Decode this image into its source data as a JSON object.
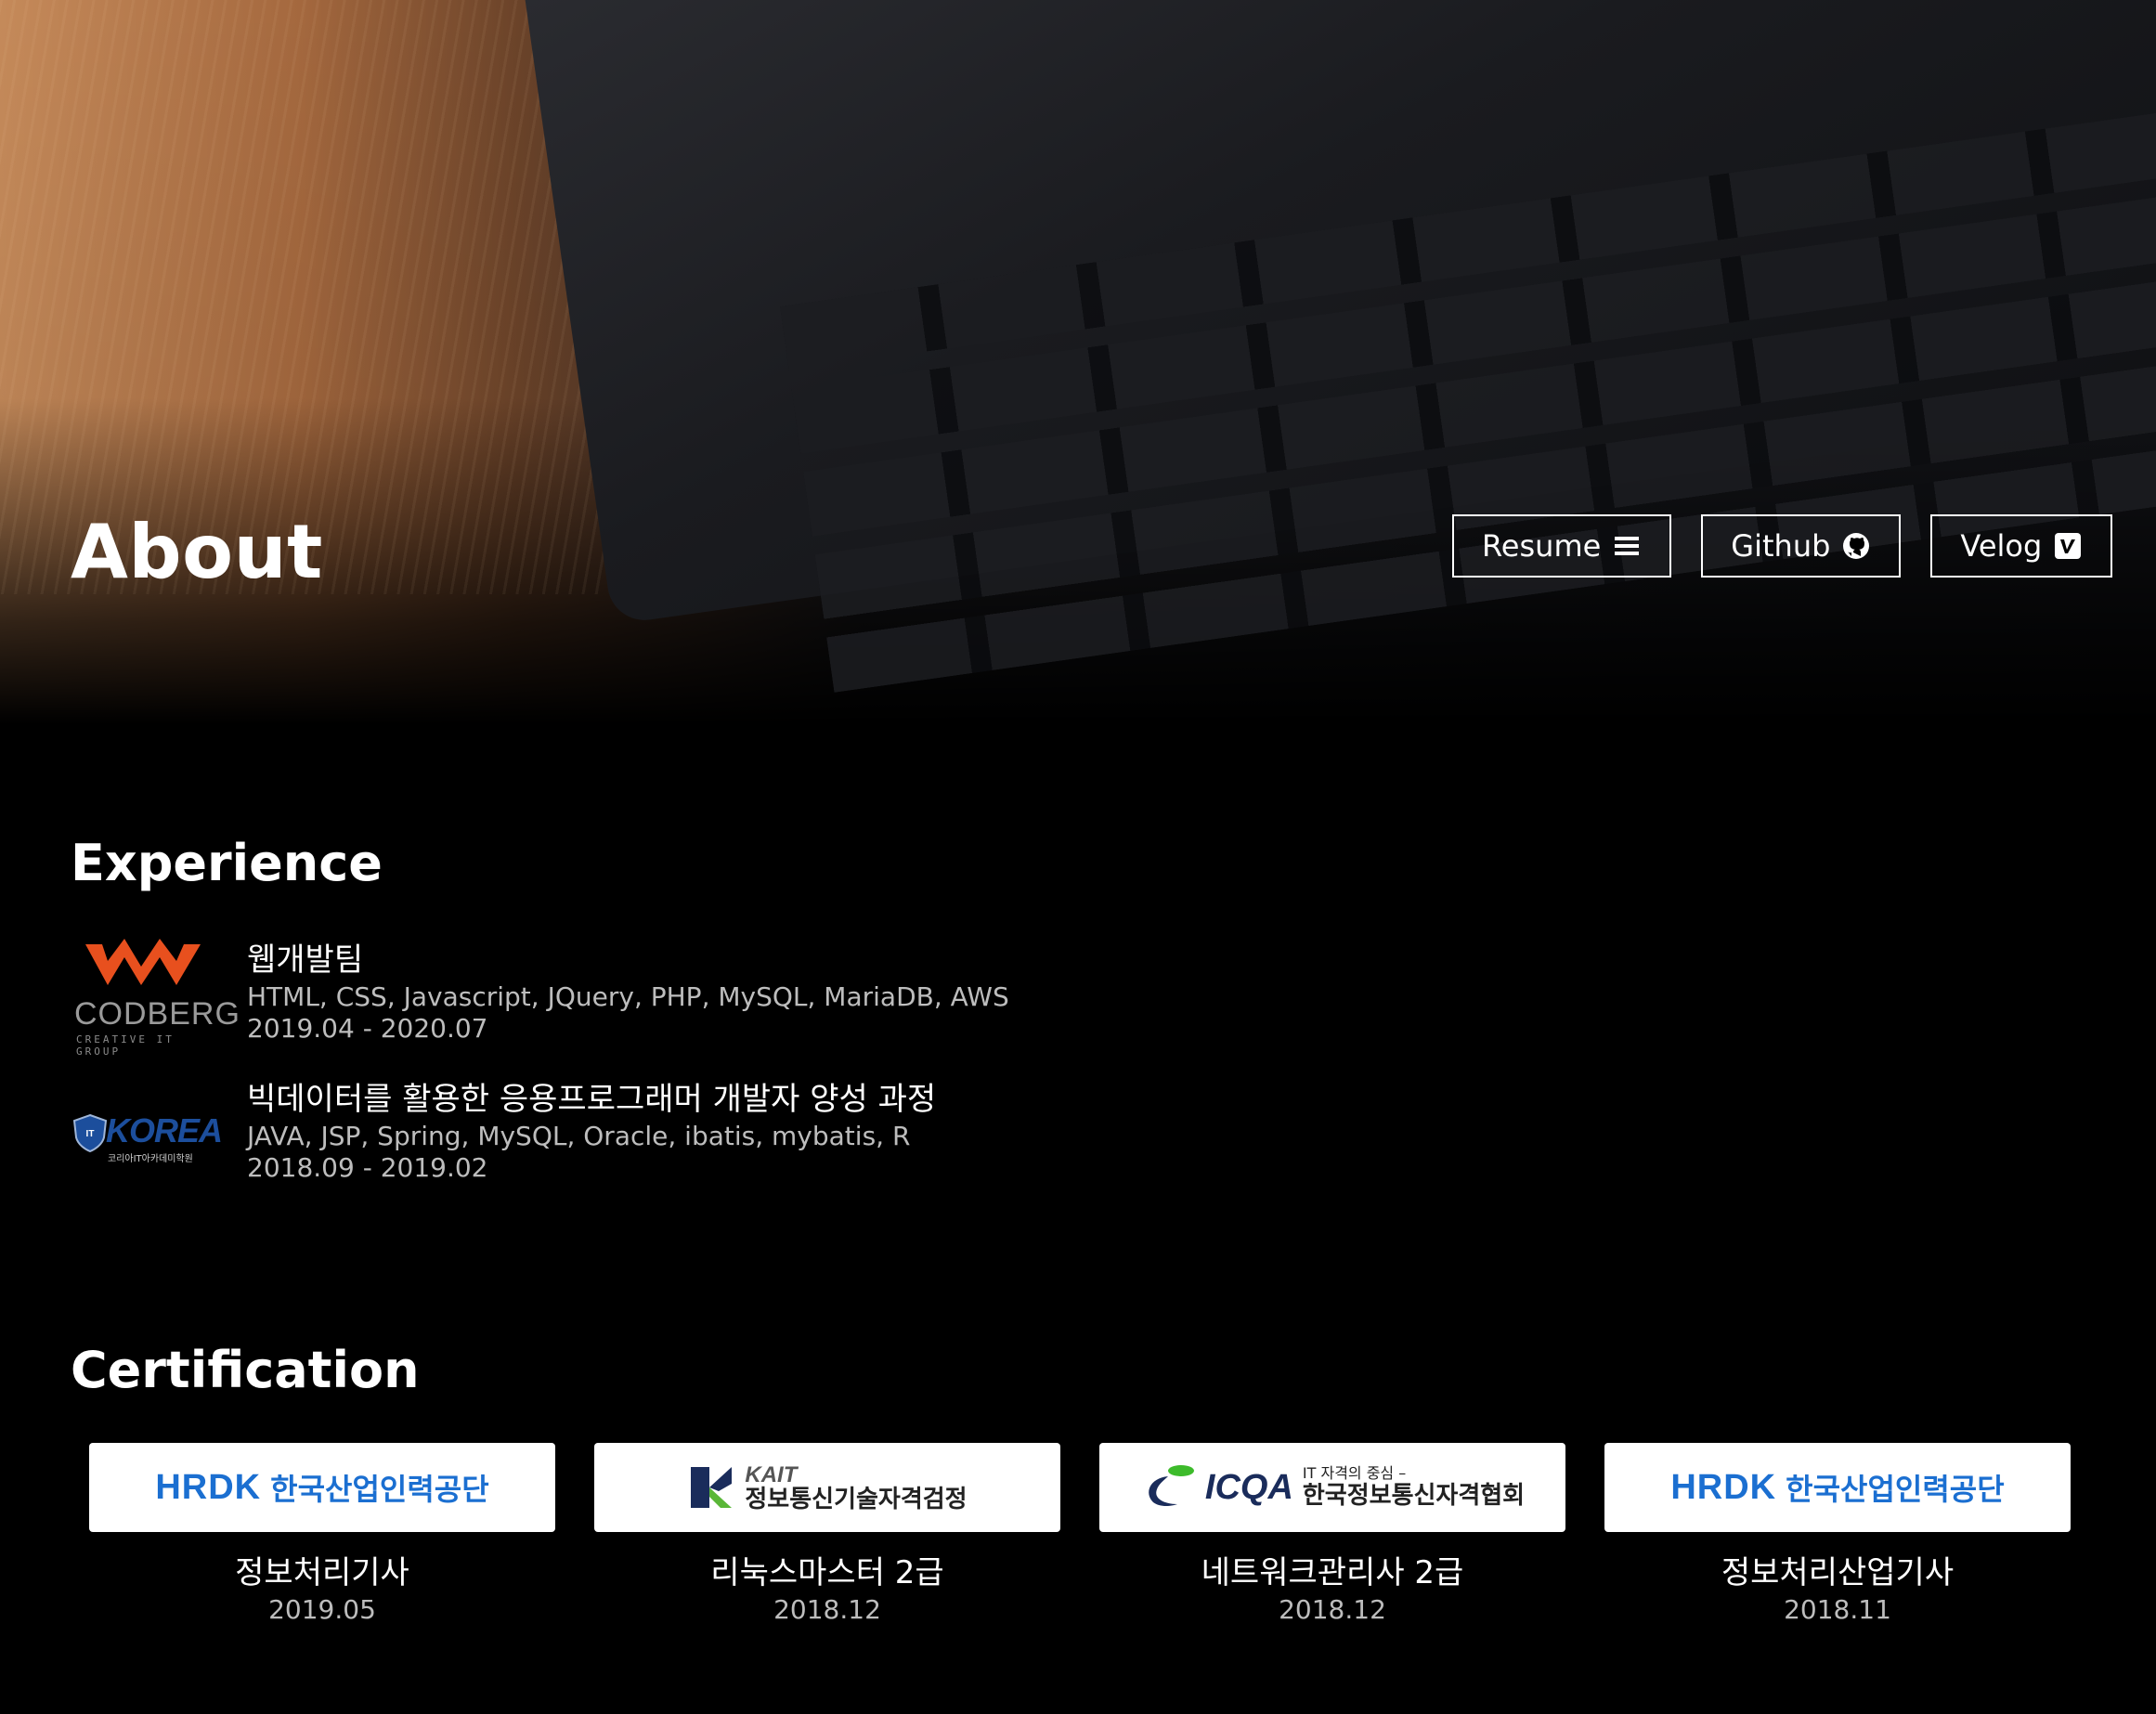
{
  "hero": {
    "title": "About",
    "buttons": [
      {
        "label": "Resume",
        "icon": "menu-icon"
      },
      {
        "label": "Github",
        "icon": "github-icon"
      },
      {
        "label": "Velog",
        "icon": "velog-icon"
      }
    ]
  },
  "experience": {
    "heading": "Experience",
    "items": [
      {
        "logo": {
          "icon": "codberg-logo",
          "text": "CODBERG",
          "tagline": "CREATIVE IT GROUP",
          "color": "#e8501e"
        },
        "name": "웹개발팀",
        "stack": "HTML, CSS, Javascript, JQuery, PHP, MySQL, MariaDB, AWS",
        "period": "2019.04 - 2020.07"
      },
      {
        "logo": {
          "icon": "korea-it-academy-logo",
          "text": "KOREA",
          "tagline": "코리아IT아카데미학원",
          "color": "#1c4e9c"
        },
        "name": "빅데이터를 활용한 응용프로그래머 개발자 양성 과정",
        "stack": "JAVA, JSP, Spring, MySQL, Oracle, ibatis, mybatis, R",
        "period": "2018.09 - 2019.02"
      }
    ]
  },
  "certification": {
    "heading": "Certification",
    "items": [
      {
        "issuer_logo": "hrdk-logo",
        "issuer_mark": "HRDK",
        "issuer_text": "한국산업인력공단",
        "name": "정보처리기사",
        "date": "2019.05"
      },
      {
        "issuer_logo": "kait-logo",
        "issuer_mark": "KAIT",
        "issuer_text": "정보통신기술자격검정",
        "name": "리눅스마스터 2급",
        "date": "2018.12"
      },
      {
        "issuer_logo": "icqa-logo",
        "issuer_mark": "ICQA",
        "issuer_tagline": "IT 자격의 중심 –",
        "issuer_text": "한국정보통신자격협회",
        "name": "네트워크관리사 2급",
        "date": "2018.12"
      },
      {
        "issuer_logo": "hrdk-logo",
        "issuer_mark": "HRDK",
        "issuer_text": "한국산업인력공단",
        "name": "정보처리산업기사",
        "date": "2018.11"
      }
    ]
  }
}
